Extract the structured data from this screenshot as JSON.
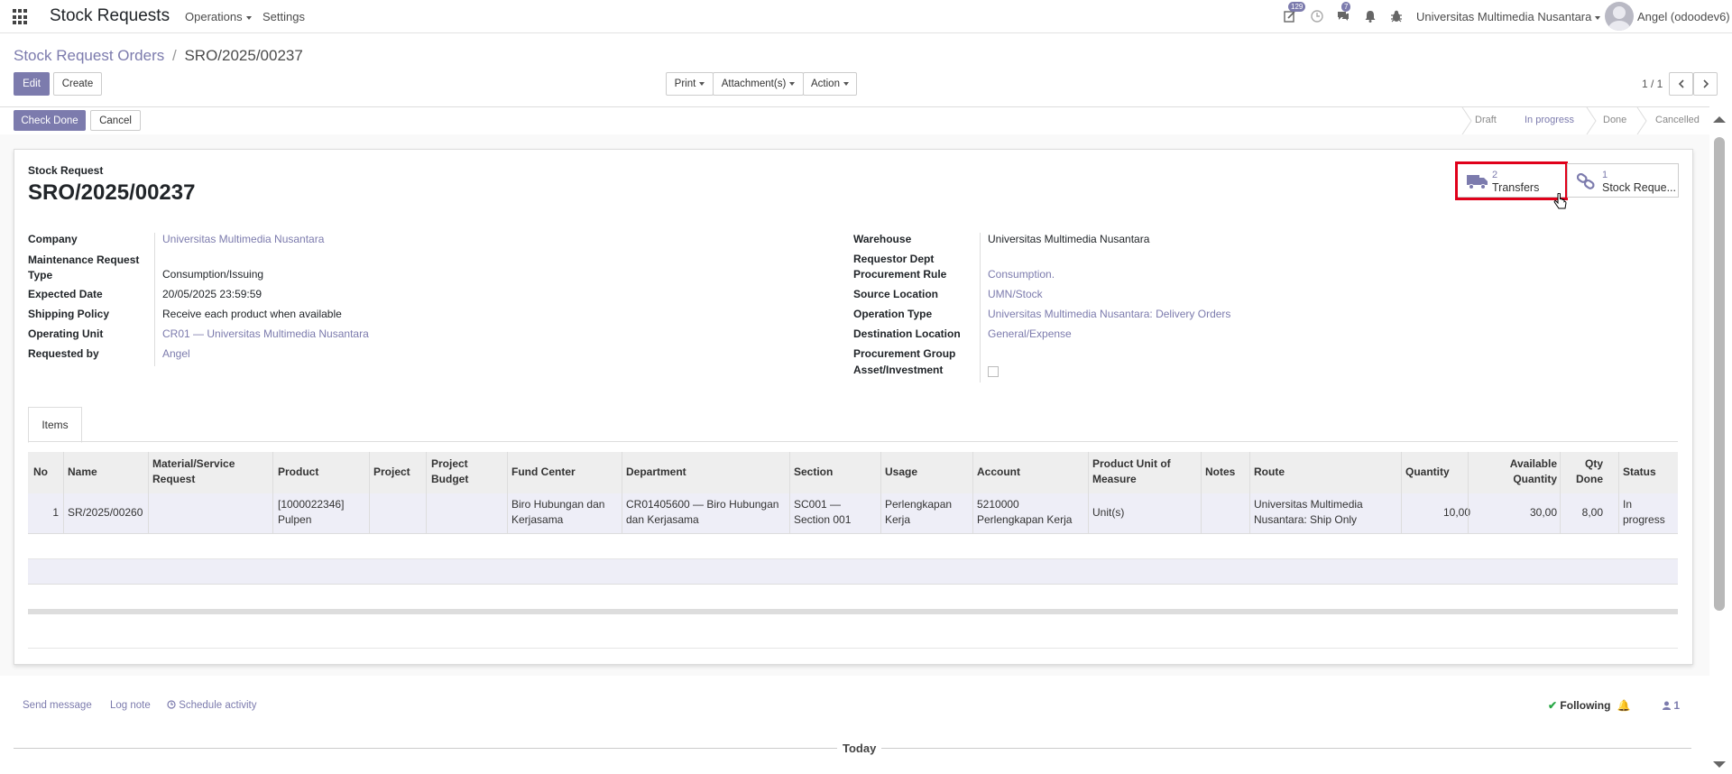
{
  "navbar": {
    "app_title": "Stock Requests",
    "menus": [
      "Operations",
      "Settings"
    ],
    "activity_badge": "129",
    "messages_badge": "7",
    "company": "Universitas Multimedia Nusantara",
    "user": "Angel (odoodev6)"
  },
  "breadcrumb": {
    "parent": "Stock Request Orders",
    "separator": "/",
    "current": "SRO/2025/00237"
  },
  "toolbar": {
    "edit": "Edit",
    "create": "Create",
    "print": "Print",
    "attachments": "Attachment(s)",
    "action": "Action",
    "pager": "1 / 1"
  },
  "status_actions": {
    "check_done": "Check Done",
    "cancel": "Cancel"
  },
  "stages": [
    "Draft",
    "In progress",
    "Done",
    "Cancelled"
  ],
  "active_stage": "In progress",
  "smart_buttons": {
    "transfers": {
      "count": "2",
      "label": "Transfers"
    },
    "stock_requests": {
      "count": "1",
      "label": "Stock Reque..."
    }
  },
  "form": {
    "subtitle": "Stock Request",
    "name": "SRO/2025/00237",
    "left": {
      "company_label": "Company",
      "company": "Universitas Multimedia Nusantara",
      "maint_label": "Maintenance Request Type",
      "maint": "Consumption/Issuing",
      "expected_label": "Expected Date",
      "expected": "20/05/2025 23:59:59",
      "shipping_label": "Shipping Policy",
      "shipping": "Receive each product when available",
      "opunit_label": "Operating Unit",
      "opunit": "CR01 — Universitas Multimedia Nusantara",
      "reqby_label": "Requested by",
      "reqby": "Angel"
    },
    "right": {
      "warehouse_label": "Warehouse",
      "warehouse": "Universitas Multimedia Nusantara",
      "reqdept_label": "Requestor Dept",
      "procrule_label": "Procurement Rule",
      "procrule": "Consumption.",
      "srcloc_label": "Source Location",
      "srcloc": "UMN/Stock",
      "optype_label": "Operation Type",
      "optype": "Universitas Multimedia Nusantara: Delivery Orders",
      "destloc_label": "Destination Location",
      "destloc": "General/Expense",
      "procgroup_label": "Procurement Group",
      "asset_label": "Asset/Investment"
    }
  },
  "tabs": {
    "items": "Items"
  },
  "table": {
    "headers": {
      "no": "No",
      "name": "Name",
      "material_1": "Material/Service",
      "material_2": "Request",
      "product": "Product",
      "project": "Project",
      "budget_1": "Project",
      "budget_2": "Budget",
      "fund": "Fund Center",
      "dept": "Department",
      "section": "Section",
      "usage": "Usage",
      "account": "Account",
      "uom_1": "Product Unit of",
      "uom_2": "Measure",
      "notes": "Notes",
      "route": "Route",
      "qty": "Quantity",
      "avail_1": "Available",
      "avail_2": "Quantity",
      "done_1": "Qty",
      "done_2": "Done",
      "status": "Status"
    },
    "row": {
      "no": "1",
      "name": "SR/2025/00260",
      "product_1": "[1000022346]",
      "product_2": "Pulpen",
      "fund_1": "Biro Hubungan dan",
      "fund_2": "Kerjasama",
      "dept_1": "CR01405600 — Biro Hubungan",
      "dept_2": "dan Kerjasama",
      "section_1": "SC001 —",
      "section_2": "Section 001",
      "usage_1": "Perlengkapan",
      "usage_2": "Kerja",
      "account_1": "5210000",
      "account_2": "Perlengkapan Kerja",
      "uom": "Unit(s)",
      "route_1": "Universitas Multimedia",
      "route_2": "Nusantara: Ship Only",
      "qty": "10,00",
      "avail": "30,00",
      "done": "8,00",
      "status_1": "In",
      "status_2": "progress"
    }
  },
  "chatter": {
    "send_message": "Send message",
    "log_note": "Log note",
    "schedule": "Schedule activity",
    "following": "Following",
    "followers": "1",
    "today": "Today"
  },
  "colors": {
    "accent": "#7c7bad",
    "highlight": "#e0001a"
  }
}
